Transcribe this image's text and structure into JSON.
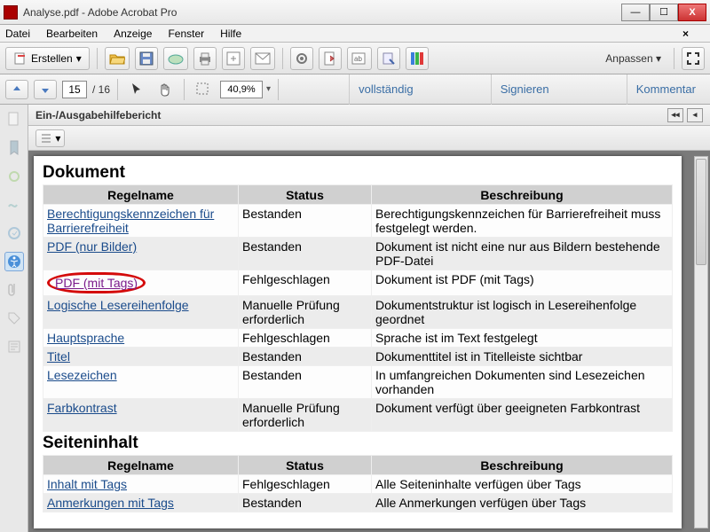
{
  "window": {
    "title": "Analyse.pdf - Adobe Acrobat Pro"
  },
  "menu": {
    "items": [
      "Datei",
      "Bearbeiten",
      "Anzeige",
      "Fenster",
      "Hilfe"
    ],
    "close": "×"
  },
  "toolbar": {
    "erstellen": "Erstellen",
    "anpassen": "Anpassen"
  },
  "nav": {
    "page": "15",
    "pages": "16",
    "zoom": "40,9%"
  },
  "rlinks": {
    "full": "vollständig",
    "sign": "Signieren",
    "comment": "Kommentar"
  },
  "report": {
    "title": "Ein-/Ausgabehilfebericht",
    "sections": [
      {
        "heading": "Dokument",
        "cols": [
          "Regelname",
          "Status",
          "Beschreibung"
        ],
        "rows": [
          {
            "name": "Berechtigungskennzeichen für Barrierefreiheit",
            "status": "Bestanden",
            "desc": "Berechtigungskennzeichen für Barrierefreiheit muss festgelegt werden."
          },
          {
            "name": "PDF (nur Bilder)",
            "status": "Bestanden",
            "desc": "Dokument ist nicht eine nur aus Bildern bestehende PDF-Datei"
          },
          {
            "name": "PDF (mit Tags)",
            "status": "Fehlgeschlagen",
            "desc": "Dokument ist PDF (mit Tags)",
            "visited": true,
            "highlight": true
          },
          {
            "name": "Logische Lesereihenfolge",
            "status": "Manuelle Prüfung erforderlich",
            "desc": "Dokumentstruktur ist logisch in Lesereihenfolge geordnet"
          },
          {
            "name": "Hauptsprache",
            "status": "Fehlgeschlagen",
            "desc": "Sprache ist im Text festgelegt"
          },
          {
            "name": "Titel",
            "status": "Bestanden",
            "desc": "Dokumenttitel ist in Titelleiste sichtbar"
          },
          {
            "name": "Lesezeichen",
            "status": "Bestanden",
            "desc": "In umfangreichen Dokumenten sind Lesezeichen vorhanden"
          },
          {
            "name": "Farbkontrast",
            "status": "Manuelle Prüfung erforderlich",
            "desc": "Dokument verfügt über geeigneten Farbkontrast"
          }
        ]
      },
      {
        "heading": "Seiteninhalt",
        "cols": [
          "Regelname",
          "Status",
          "Beschreibung"
        ],
        "rows": [
          {
            "name": "Inhalt mit Tags",
            "status": "Fehlgeschlagen",
            "desc": "Alle Seiteninhalte verfügen über Tags"
          },
          {
            "name": "Anmerkungen mit Tags",
            "status": "Bestanden",
            "desc": "Alle Anmerkungen verfügen über Tags"
          }
        ]
      }
    ]
  }
}
